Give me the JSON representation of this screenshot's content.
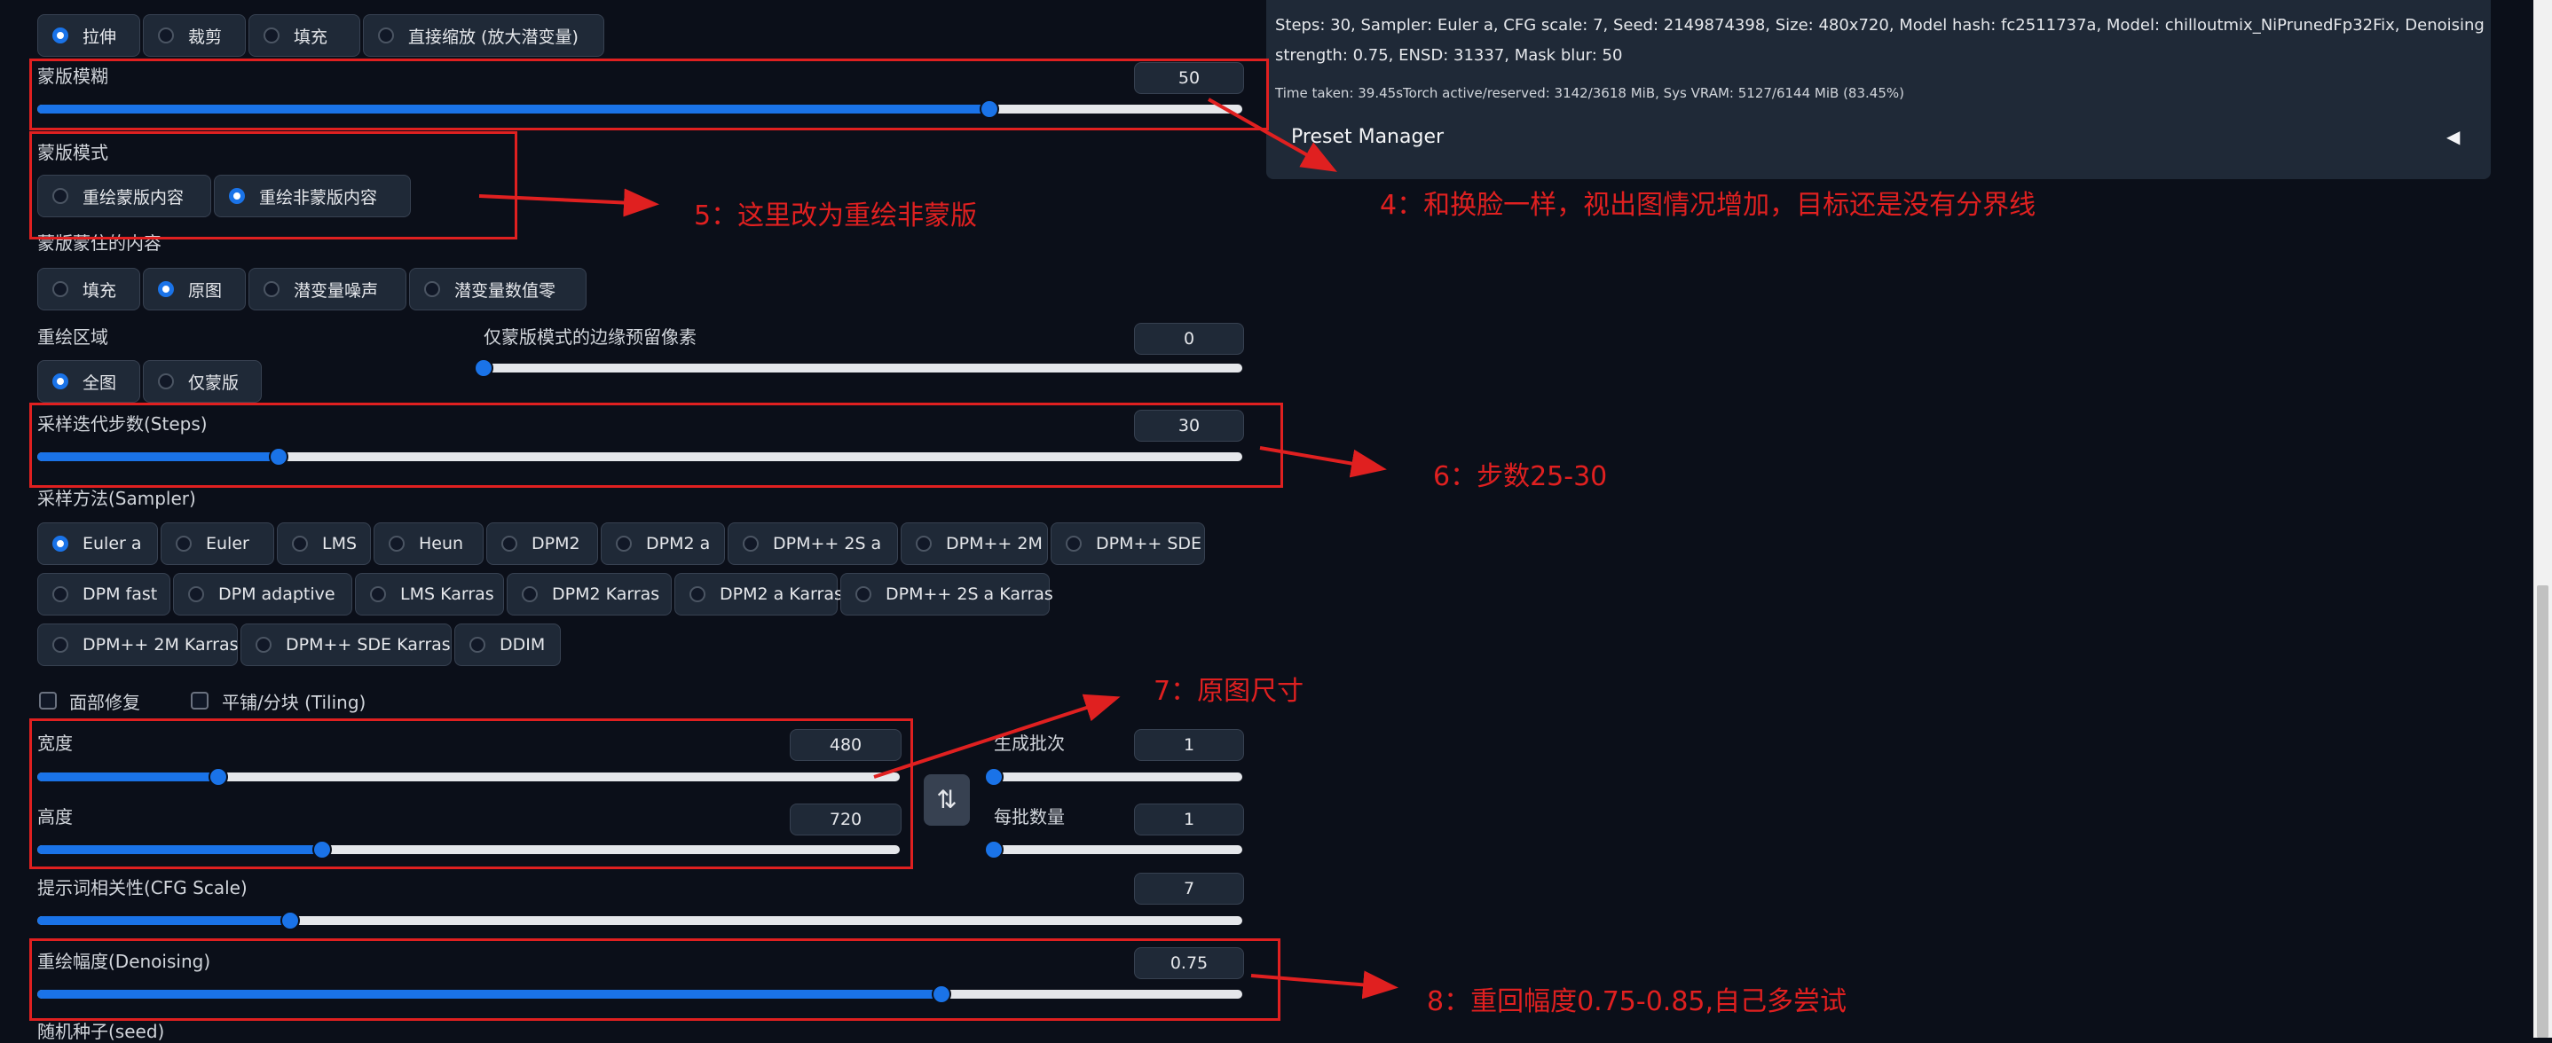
{
  "resize_modes": [
    {
      "label": "拉伸",
      "selected": true
    },
    {
      "label": "裁剪",
      "selected": false
    },
    {
      "label": "填充",
      "selected": false
    },
    {
      "label": "直接缩放 (放大潜变量)",
      "selected": false
    }
  ],
  "mask_blur": {
    "label": "蒙版模糊",
    "value": "50",
    "fraction": 0.79
  },
  "mask_mode": {
    "label": "蒙版模式",
    "options": [
      {
        "label": "重绘蒙版内容",
        "selected": false
      },
      {
        "label": "重绘非蒙版内容",
        "selected": true
      }
    ]
  },
  "masked_content": {
    "label": "蒙版蒙住的内容",
    "options": [
      {
        "label": "填充",
        "selected": false
      },
      {
        "label": "原图",
        "selected": true
      },
      {
        "label": "潜变量噪声",
        "selected": false
      },
      {
        "label": "潜变量数值零",
        "selected": false
      }
    ]
  },
  "inpaint_area": {
    "label": "重绘区域",
    "options": [
      {
        "label": "全图",
        "selected": true
      },
      {
        "label": "仅蒙版",
        "selected": false
      }
    ]
  },
  "only_masked_padding": {
    "label": "仅蒙版模式的边缘预留像素",
    "value": "0",
    "fraction": 0.0
  },
  "steps": {
    "label": "采样迭代步数(Steps)",
    "value": "30",
    "fraction": 0.2
  },
  "sampler": {
    "label": "采样方法(Sampler)",
    "rows": [
      [
        {
          "label": "Euler a",
          "selected": true
        },
        {
          "label": "Euler",
          "selected": false
        },
        {
          "label": "LMS",
          "selected": false
        },
        {
          "label": "Heun",
          "selected": false
        },
        {
          "label": "DPM2",
          "selected": false
        },
        {
          "label": "DPM2 a",
          "selected": false
        },
        {
          "label": "DPM++ 2S a",
          "selected": false
        },
        {
          "label": "DPM++ 2M",
          "selected": false
        },
        {
          "label": "DPM++ SDE",
          "selected": false
        }
      ],
      [
        {
          "label": "DPM fast",
          "selected": false
        },
        {
          "label": "DPM adaptive",
          "selected": false
        },
        {
          "label": "LMS Karras",
          "selected": false
        },
        {
          "label": "DPM2 Karras",
          "selected": false
        },
        {
          "label": "DPM2 a Karras",
          "selected": false
        },
        {
          "label": "DPM++ 2S a Karras",
          "selected": false
        }
      ],
      [
        {
          "label": "DPM++ 2M Karras",
          "selected": false
        },
        {
          "label": "DPM++ SDE Karras",
          "selected": false
        },
        {
          "label": "DDIM",
          "selected": false
        }
      ]
    ]
  },
  "checkboxes": [
    {
      "label": "面部修复",
      "checked": false
    },
    {
      "label": "平铺/分块 (Tiling)",
      "checked": false
    }
  ],
  "width": {
    "label": "宽度",
    "value": "480",
    "fraction": 0.21
  },
  "height": {
    "label": "高度",
    "value": "720",
    "fraction": 0.33
  },
  "swap_icon": "⇅",
  "batch_count": {
    "label": "生成批次",
    "value": "1",
    "fraction": 0.0
  },
  "batch_size": {
    "label": "每批数量",
    "value": "1",
    "fraction": 0.0
  },
  "cfg": {
    "label": "提示词相关性(CFG Scale)",
    "value": "7",
    "fraction": 0.21
  },
  "denoising": {
    "label": "重绘幅度(Denoising)",
    "value": "0.75",
    "fraction": 0.75
  },
  "seed": {
    "label": "随机种子(seed)"
  },
  "info": {
    "line0": "Steps: 30, Sampler: Euler a, CFG scale: 7, Seed: 2149874398, Size: 480x720, Model hash: fc2511737a, Model: chilloutmix_NiPrunedFp32Fix, Denoising",
    "line1": "strength: 0.75, ENSD: 31337, Mask blur: 50",
    "time": "Time taken: 39.45sTorch active/reserved: 3142/3618 MiB, Sys VRAM: 5127/6144 MiB (83.45%)",
    "preset_manager": "Preset Manager",
    "collapse_icon": "◀"
  },
  "annotations": {
    "a4": "4：和换脸一样，视出图情况增加，目标还是没有分界线",
    "a5": "5：这里改为重绘非蒙版",
    "a6": "6：步数25-30",
    "a7": "7：原图尺寸",
    "a8": "8：重回幅度0.75-0.85,自己多尝试"
  },
  "colors": {
    "accent": "#1a73e8",
    "annotation": "#e02020",
    "background": "#0b0f19"
  }
}
